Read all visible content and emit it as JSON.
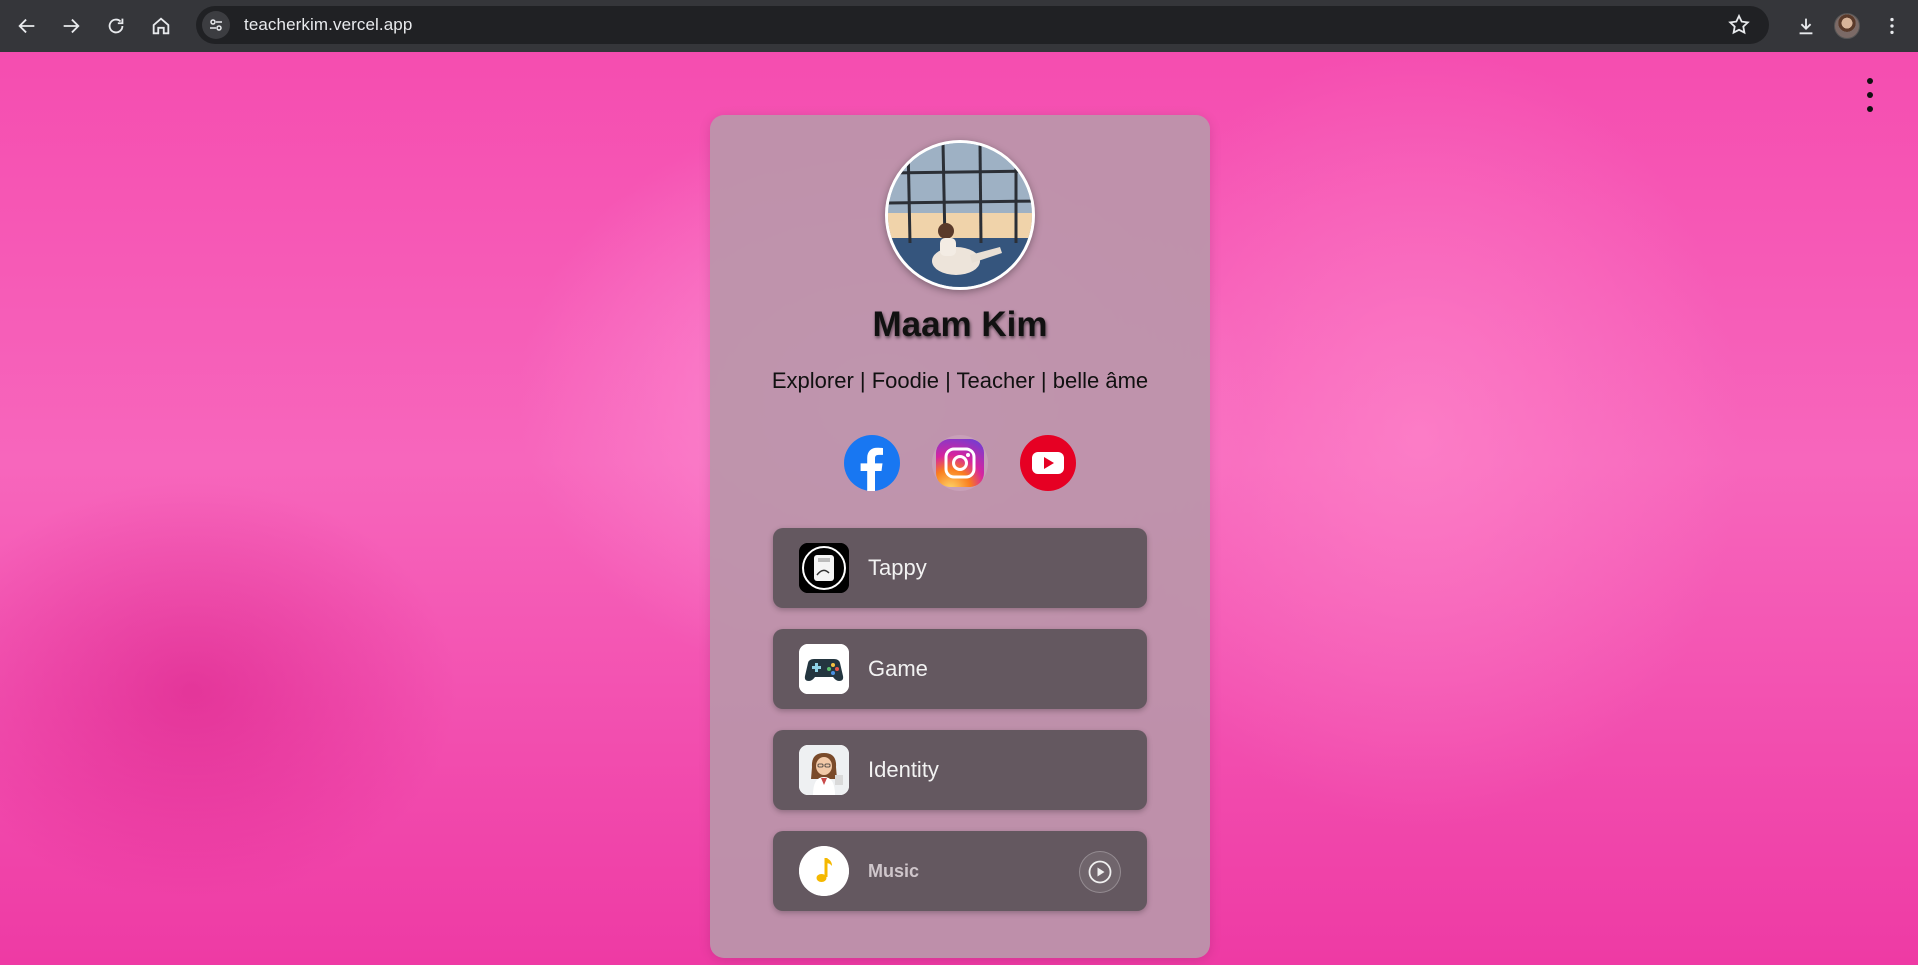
{
  "browser": {
    "url": "teacherkim.vercel.app"
  },
  "profile": {
    "name": "Maam Kim",
    "tagline": "Explorer | Foodie | Teacher | belle âme"
  },
  "socials": [
    {
      "name": "facebook",
      "color": "#1877f2"
    },
    {
      "name": "instagram",
      "color": "#d6249f"
    },
    {
      "name": "youtube",
      "color": "#e60023"
    }
  ],
  "links": [
    {
      "label": "Tappy",
      "icon": "tappy-icon"
    },
    {
      "label": "Game",
      "icon": "gamepad-icon"
    },
    {
      "label": "Identity",
      "icon": "teacher-avatar-icon"
    }
  ],
  "music": {
    "label": "Music",
    "icon": "music-note-icon",
    "control": "play-icon"
  },
  "colors": {
    "background": "#f766bc",
    "card": "#ba96aa",
    "link_button": "#645860"
  }
}
